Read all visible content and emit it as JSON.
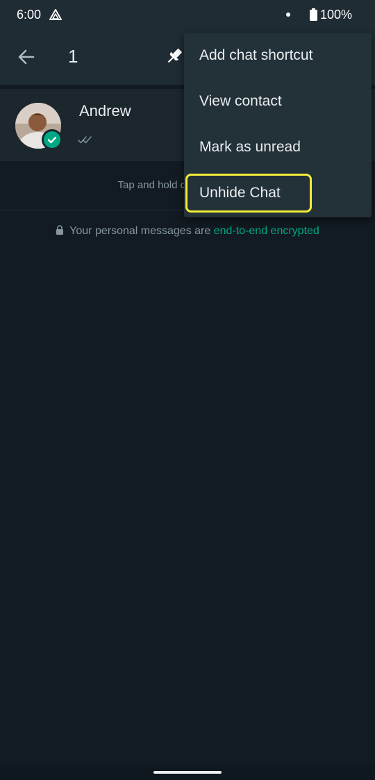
{
  "status_bar": {
    "time": "6:00",
    "battery": "100%"
  },
  "app_bar": {
    "selected_count": "1"
  },
  "chat": {
    "contact_name": "Andrew"
  },
  "hint": "Tap and hold on a c",
  "encryption": {
    "prefix": "Your personal messages are ",
    "link": "end-to-end encrypted"
  },
  "menu": {
    "items": [
      {
        "label": "Add chat shortcut"
      },
      {
        "label": "View contact"
      },
      {
        "label": "Mark as unread"
      },
      {
        "label": "Unhide Chat"
      }
    ]
  },
  "colors": {
    "accent": "#00a884",
    "highlight": "#f5ec3a",
    "background": "#121b22",
    "bar": "#1f2c34"
  },
  "icons": [
    "drive-icon",
    "battery-icon",
    "back-arrow-icon",
    "pin-icon",
    "check-badge-icon",
    "double-tick-icon",
    "lock-icon"
  ]
}
